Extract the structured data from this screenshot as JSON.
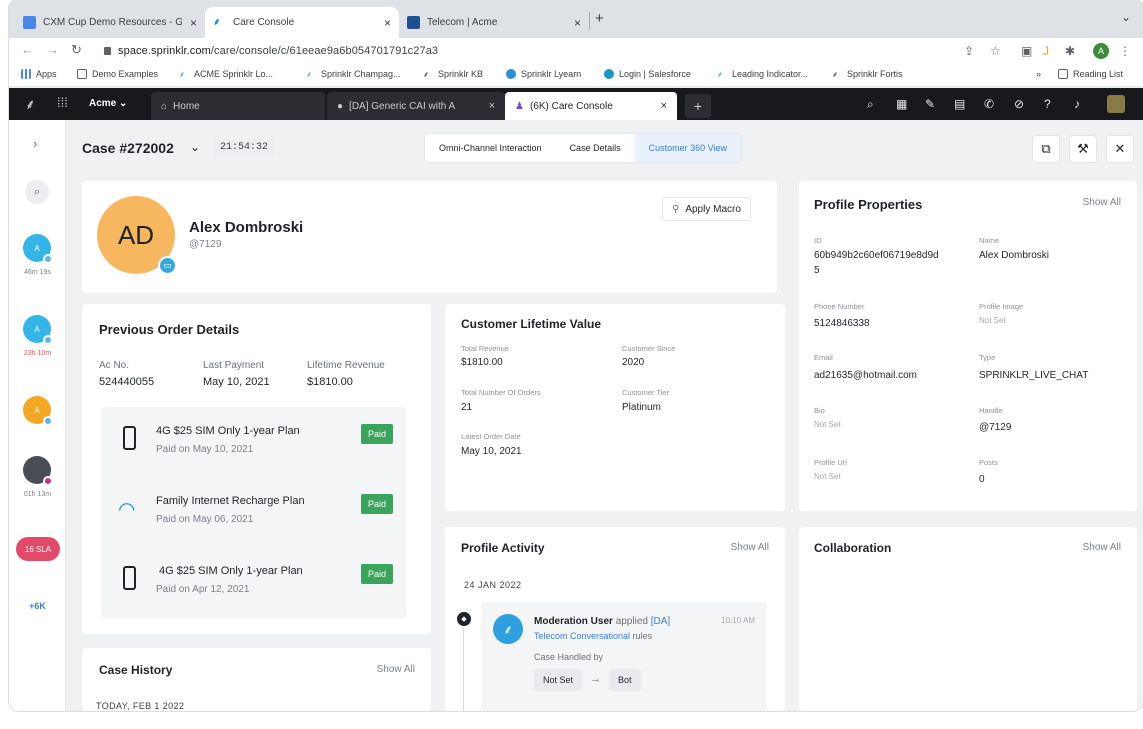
{
  "browser": {
    "tabs": [
      {
        "label": "CXM Cup Demo Resources - G",
        "close": "×"
      },
      {
        "label": "Care Console",
        "close": "×"
      },
      {
        "label": "Telecom | Acme",
        "close": "×"
      }
    ],
    "new_tab": "+",
    "tab_list_icon": "⌄",
    "url_host": "space.sprinklr.com",
    "url_path": "/care/console/c/61eeae9a6b054701791c27a3",
    "bookmarks": [
      "Apps",
      "Demo Examples",
      "ACME Sprinklr Lo...",
      "Sprinklr Champag...",
      "Sprinklr KB",
      "Sprinklr Lyearn",
      "Login | Salesforce",
      "Leading Indicator...",
      "Sprinklr Fortis"
    ],
    "bookmarks_more": "»",
    "reading_list": "Reading List",
    "profile_initial": "A"
  },
  "app": {
    "workspace": "Acme",
    "tabs": [
      {
        "label": "Home"
      },
      {
        "label": "[DA] Generic CAI with A",
        "close": "×"
      },
      {
        "label": "(6K) Care Console",
        "close": "×"
      }
    ],
    "add_tab": "+"
  },
  "rail": {
    "expand": "›",
    "avatars": [
      {
        "initial": "A",
        "time": "46m 19s",
        "color": "#33b5e8",
        "time_color": "#7a7f88"
      },
      {
        "initial": "A",
        "time": "23h 10m",
        "color": "#33b5e8",
        "time_color": "#e2574c"
      },
      {
        "initial": "A",
        "time": "",
        "color": "#f5a623",
        "time_color": "#7a7f88"
      },
      {
        "initial": "",
        "time": "01h 13m",
        "color": "#4a4d53",
        "time_color": "#7a7f88"
      }
    ],
    "sla_badge": "16 SLA",
    "more": "+6K"
  },
  "case": {
    "title": "Case #272002",
    "timer": "21:54:32",
    "views": [
      "Omni-Channel Interaction",
      "Case Details",
      "Customer 360 View"
    ]
  },
  "profile": {
    "initials": "AD",
    "name": "Alex Dombroski",
    "handle": "@7129",
    "apply_macro": "Apply Macro"
  },
  "orders": {
    "title": "Previous Order Details",
    "ac_label": "Ac No.",
    "ac_value": "524440055",
    "last_payment_label": "Last Payment",
    "last_payment_value": "May 10, 2021",
    "lifetime_label": "Lifetime Revenue",
    "lifetime_value": "$1810.00",
    "items": [
      {
        "name": "4G $25 SIM Only 1-year Plan",
        "date": "Paid on May 10, 2021",
        "status": "Paid",
        "icon": "phone-icon"
      },
      {
        "name": "Family Internet Recharge Plan",
        "date": "Paid on May 06, 2021",
        "status": "Paid",
        "icon": "wifi-icon"
      },
      {
        "name": "4G $25 SIM Only 1-year Plan",
        "date": "Paid on Apr 12, 2021",
        "status": "Paid",
        "icon": "phone-icon"
      }
    ]
  },
  "clv": {
    "title": "Customer Lifetime Value",
    "total_revenue_label": "Total Revenue",
    "total_revenue_value": "$1810.00",
    "customer_since_label": "Customer Since",
    "customer_since_value": "2020",
    "total_orders_label": "Total Number Of Orders",
    "total_orders_value": "21",
    "tier_label": "Customer Tier",
    "tier_value": "Platinum",
    "latest_order_label": "Latest Order Date",
    "latest_order_value": "May 10, 2021"
  },
  "properties": {
    "title": "Profile Properties",
    "show_all": "Show All",
    "id_label": "ID",
    "id_value_line1": "60b949b2c60ef06719e8d9d",
    "id_value_line2": "5",
    "name_label": "Name",
    "name_value": "Alex Dombroski",
    "phone_label": "Phone Number",
    "phone_value": "5124846338",
    "image_label": "Profile Image",
    "image_value": "Not Set",
    "email_label": "Email",
    "email_value": "ad21635@hotmail.com",
    "type_label": "Type",
    "type_value": "SPRINKLR_LIVE_CHAT",
    "bio_label": "Bio",
    "bio_value": "Not Set",
    "handle_label": "Handle",
    "handle_value": "@7129",
    "url_label": "Profile Url",
    "url_value": "Not Set",
    "posts_label": "Posts",
    "posts_value": "0"
  },
  "activity": {
    "title": "Profile Activity",
    "show_all": "Show All",
    "date": "24 JAN 2022",
    "user": "Moderation User",
    "action": "applied",
    "rule_tag": "[DA]",
    "rule_name": "Telecom Conversational",
    "rule_suffix": "rules",
    "time": "10:10 AM",
    "sub": "Case Handled by",
    "from": "Not Set",
    "arrow": "→",
    "to": "Bot"
  },
  "collaboration": {
    "title": "Collaboration",
    "show_all": "Show All"
  },
  "history": {
    "title": "Case History",
    "show_all": "Show All",
    "date": "TODAY, FEB 1 2022"
  }
}
